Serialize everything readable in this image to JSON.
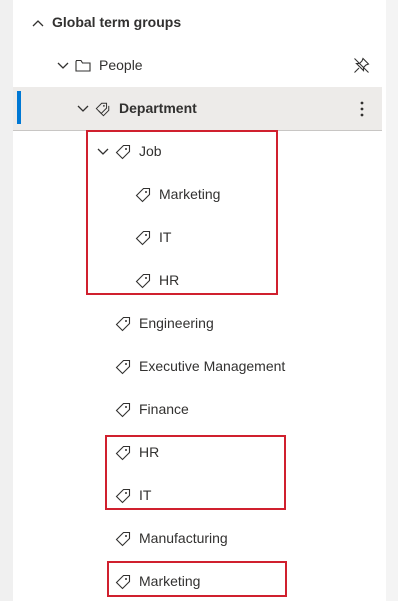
{
  "tree": {
    "root": {
      "label": "Global term groups"
    },
    "group": {
      "label": "People"
    },
    "term_set": {
      "label": "Department"
    },
    "job": {
      "label": "Job"
    },
    "job_children": [
      {
        "label": "Marketing"
      },
      {
        "label": "IT"
      },
      {
        "label": "HR"
      }
    ],
    "terms": [
      {
        "label": "Engineering"
      },
      {
        "label": "Executive Management"
      },
      {
        "label": "Finance"
      },
      {
        "label": "HR"
      },
      {
        "label": "IT"
      },
      {
        "label": "Manufacturing"
      },
      {
        "label": "Marketing"
      }
    ]
  },
  "colors": {
    "accent": "#0078d4",
    "highlight": "#d0202e",
    "selected_bg": "#edebe9"
  }
}
